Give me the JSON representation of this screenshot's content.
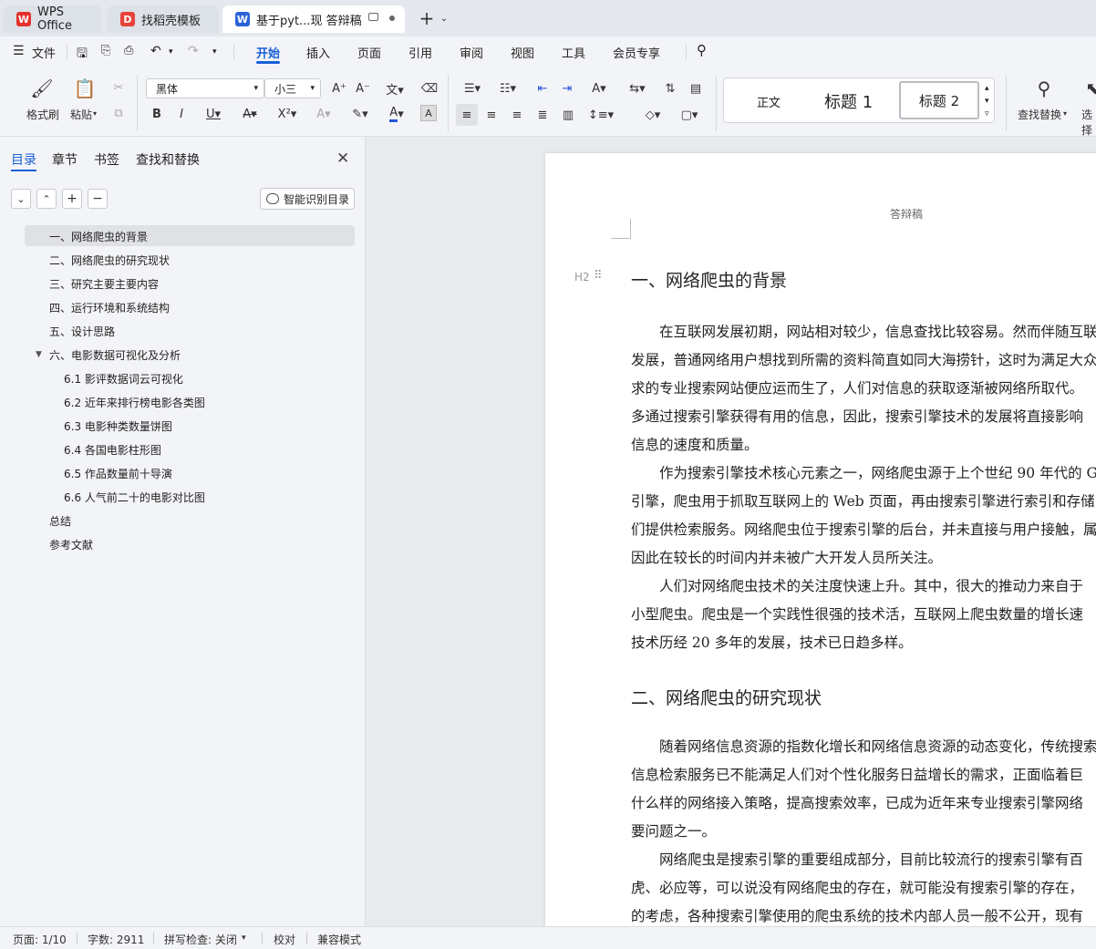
{
  "tabs": [
    {
      "label": "WPS Office"
    },
    {
      "label": "找稻壳模板"
    },
    {
      "label": "基于pyt...现 答辩稿"
    }
  ],
  "menu": {
    "file": "文件",
    "items": [
      "开始",
      "插入",
      "页面",
      "引用",
      "审阅",
      "视图",
      "工具",
      "会员专享"
    ]
  },
  "toolbar": {
    "format_painter": "格式刷",
    "paste": "粘贴",
    "font_name": "黑体",
    "font_size": "小三",
    "styles": [
      "正文",
      "标题 1",
      "标题 2"
    ],
    "find_replace": "查找替换",
    "select": "选择"
  },
  "sidebar": {
    "tabs": [
      "目录",
      "章节",
      "书签",
      "查找和替换"
    ],
    "smart_btn": "智能识别目录",
    "toc": [
      {
        "label": "一、网络爬虫的背景",
        "level": 1
      },
      {
        "label": "二、网络爬虫的研究现状",
        "level": 1
      },
      {
        "label": "三、研究主要主要内容",
        "level": 1
      },
      {
        "label": "四、运行环境和系统结构",
        "level": 1
      },
      {
        "label": "五、设计思路",
        "level": 1
      },
      {
        "label": "六、电影数据可视化及分析",
        "level": 1
      },
      {
        "label": "6.1 影评数据词云可视化",
        "level": 2
      },
      {
        "label": "6.2 近年来排行榜电影各类图",
        "level": 2
      },
      {
        "label": "6.3 电影种类数量饼图",
        "level": 2
      },
      {
        "label": "6.4 各国电影柱形图",
        "level": 2
      },
      {
        "label": "6.5 作品数量前十导演",
        "level": 2
      },
      {
        "label": "6.6 人气前二十的电影对比图",
        "level": 2
      },
      {
        "label": "总结",
        "level": 1
      },
      {
        "label": "参考文献",
        "level": 1
      }
    ]
  },
  "document": {
    "header": "答辩稿",
    "heading_marker": "H2",
    "h1": "一、网络爬虫的背景",
    "p1": [
      "　　在互联网发展初期，网站相对较少，信息查找比较容易。然而伴随互联",
      "发展，普通网络用户想找到所需的资料简直如同大海捞针，这时为满足大众",
      "求的专业搜索网站便应运而生了，人们对信息的获取逐渐被网络所取代。",
      "多通过搜索引擎获得有用的信息，因此，搜索引擎技术的发展将直接影响",
      "信息的速度和质量。",
      "　　作为搜索引擎技术核心元素之一，网络爬虫源于上个世纪 90 年代的 G",
      "引擎，爬虫用于抓取互联网上的 Web 页面，再由搜索引擎进行索引和存储",
      "们提供检索服务。网络爬虫位于搜索引擎的后台，并未直接与用户接触，属",
      "因此在较长的时间内并未被广大开发人员所关注。",
      "　　人们对网络爬虫技术的关注度快速上升。其中，很大的推动力来自于",
      "小型爬虫。爬虫是一个实践性很强的技术活，互联网上爬虫数量的增长速",
      "技术历经 20 多年的发展，技术已日趋多样。"
    ],
    "h2": "二、网络爬虫的研究现状",
    "p2": [
      "　　随着网络信息资源的指数化增长和网络信息资源的动态变化，传统搜索",
      "信息检索服务已不能满足人们对个性化服务日益增长的需求，正面临着巨",
      "什么样的网络接入策略，提高搜索效率，已成为近年来专业搜索引擎网络",
      "要问题之一。",
      "　　网络爬虫是搜索引擎的重要组成部分，目前比较流行的搜索引擎有百",
      "虎、必应等，可以说没有网络爬虫的存在，就可能没有搜索引擎的存在，",
      "的考虑，各种搜索引擎使用的爬虫系统的技术内部人员一般不公开，现有"
    ]
  },
  "status": {
    "page": "页面: 1/10",
    "words": "字数: 2911",
    "spell": "拼写检查: 关闭",
    "proof": "校对",
    "compat": "兼容模式"
  }
}
